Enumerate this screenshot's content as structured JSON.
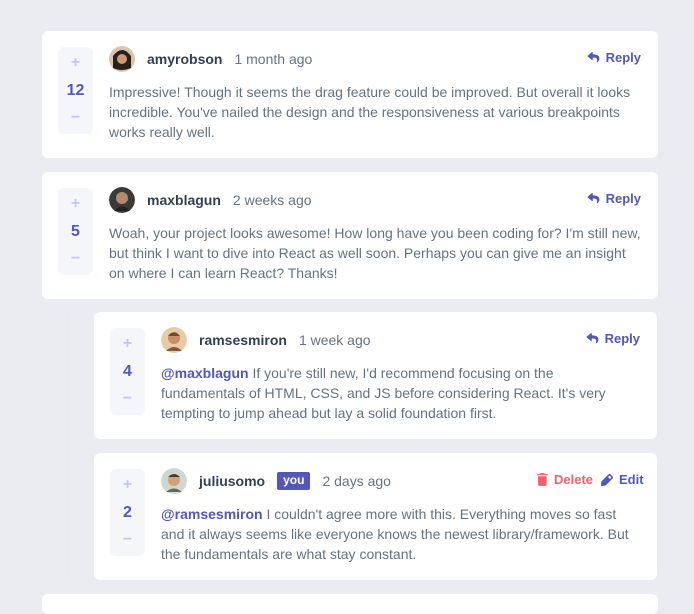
{
  "colors": {
    "background": "#eaecf1",
    "card": "#ffffff",
    "moderate_blue": "#5357b6",
    "light_grayish_blue": "#c5c6ef",
    "soft_red": "#ed6368",
    "dark_blue": "#324152",
    "grayish_blue": "#67727e"
  },
  "icons": {
    "reply": "reply-icon",
    "delete": "delete-icon",
    "edit": "edit-icon",
    "plus": "plus-icon",
    "minus": "minus-icon"
  },
  "vote": {
    "plus": "+",
    "minus": "−"
  },
  "actions": {
    "reply": "Reply",
    "delete": "Delete",
    "edit": "Edit"
  },
  "comments": [
    {
      "username": "amyrobson",
      "time": "1 month ago",
      "score": "12",
      "content": "Impressive! Though it seems the drag feature could be improved. But overall it looks incredible. You've nailed the design and the responsiveness at various breakpoints works really well."
    },
    {
      "username": "maxblagun",
      "time": "2 weeks ago",
      "score": "5",
      "content": "Woah, your project looks awesome! How long have you been coding for? I'm still new, but think I want to dive into React as well soon. Perhaps you can give me an insight on where I can learn React? Thanks!"
    }
  ],
  "replies": [
    {
      "username": "ramsesmiron",
      "time": "1 week ago",
      "score": "4",
      "mention": "@maxblagun",
      "content": " If you're still new, I'd recommend focusing on the fundamentals of HTML, CSS, and JS before considering React. It's very tempting to jump ahead but lay a solid foundation first."
    },
    {
      "username": "juliusomo",
      "you_badge": "you",
      "time": "2 days ago",
      "score": "2",
      "mention": "@ramsesmiron",
      "content": " I couldn't agree more with this. Everything moves so fast and it always seems like everyone knows the newest library/framework. But the fundamentals are what stay constant."
    }
  ]
}
